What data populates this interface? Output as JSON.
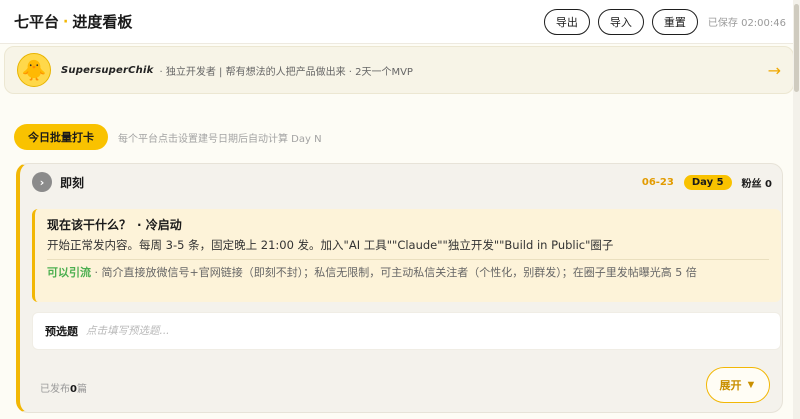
{
  "header": {
    "title_part1": "七平台",
    "title_dot": "·",
    "title_part2": "进度看板",
    "buttons": {
      "export": "导出",
      "import": "导入",
      "reset": "重置"
    },
    "saved_status": "已保存 02:00:46"
  },
  "profile": {
    "avatar_icon": "🐥",
    "name": "SupersuperChik",
    "bio": "· 独立开发者 | 帮有想法的人把产品做出来 · 2天一个MVP",
    "arrow_icon": "→"
  },
  "batch": {
    "button_label": "今日批量打卡",
    "hint": "每个平台点击设置建号日期后自动计算 Day N"
  },
  "card": {
    "collapse_icon": "›",
    "platform": "即刻",
    "date": "06-23",
    "day": "Day 5",
    "fans_label": "粉丝",
    "fans_value": "0",
    "advice": {
      "title": "现在该干什么？",
      "stage": "· 冷启动",
      "body": "开始正常发内容。每周 3-5 条，固定晚上 21:00 发。加入\"AI 工具\"\"Claude\"\"独立开发\"\"Build in Public\"圈子",
      "tip_label": "可以引流",
      "tip_text": " · 简介直接放微信号+官网链接（即刻不封）；私信无限制，可主动私信关注者（个性化，别群发）；在圈子里发帖曝光高 5 倍"
    },
    "topic": {
      "label": "预选题",
      "placeholder": "点击填写预选题..."
    },
    "published_prefix": "已发布",
    "published_count": "0",
    "published_suffix": "篇",
    "expand_label": "展开",
    "expand_icon": "▼"
  },
  "colors": {
    "accent": "#f9c200",
    "accent_dark": "#e29b00",
    "tip_green": "#4caf50"
  }
}
